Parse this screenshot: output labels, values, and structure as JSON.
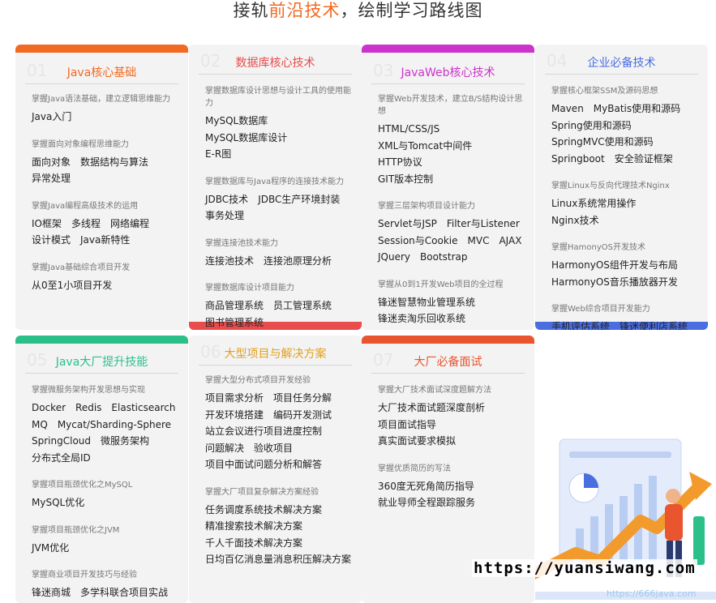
{
  "title": {
    "prefix": "接轨",
    "highlight": "前沿技术",
    "suffix": "，绘制学习路线图"
  },
  "cards": [
    {
      "num": "01",
      "title": "Java核心基础",
      "color": "#f26a21",
      "sections": [
        {
          "cap": "掌握Java语法基础，建立逻辑思维能力",
          "items": [
            "Java入门"
          ]
        },
        {
          "cap": "掌握面向对象编程思维能力",
          "items": [
            "面向对象",
            "数据结构与算法",
            "异常处理"
          ]
        },
        {
          "cap": "掌握Java编程高级技术的运用",
          "items": [
            "IO框架",
            "多线程",
            "网络编程",
            "设计模式",
            "Java新特性"
          ]
        },
        {
          "cap": "掌握Java基础综合项目开发",
          "items": [
            "从0至1小项目开发"
          ]
        }
      ]
    },
    {
      "num": "02",
      "title": "数据库核心技术",
      "color": "#e84c4c",
      "sections": [
        {
          "cap": "掌握数据库设计思想与设计工具的使用能力",
          "items": [
            "MySQL数据库",
            "MySQL数据库设计",
            "E-R图"
          ]
        },
        {
          "cap": "掌握数据库与Java程序的连接技术能力",
          "items": [
            "JDBC技术",
            "JDBC生产环境封装",
            "事务处理"
          ]
        },
        {
          "cap": "掌握连接池技术能力",
          "items": [
            "连接池技术",
            "连接池原理分析"
          ]
        },
        {
          "cap": "掌握数据库设计项目能力",
          "items": [
            "商品管理系统",
            "员工管理系统",
            "图书管理系统"
          ]
        }
      ]
    },
    {
      "num": "03",
      "title": "JavaWeb核心技术",
      "color": "#cc33cc",
      "sections": [
        {
          "cap": "掌握Web开发技术，建立B/S结构设计思想",
          "items": [
            "HTML/CSS/JS",
            "XML与Tomcat中间件",
            "HTTP协议",
            "GIT版本控制"
          ]
        },
        {
          "cap": "掌握三层架构项目设计能力",
          "items": [
            "Servlet与JSP",
            "Filter与Listener",
            "Session与Cookie",
            "MVC",
            "AJAX",
            "JQuery",
            "Bootstrap"
          ]
        },
        {
          "cap": "掌握从0到1开发Web项目的全过程",
          "items": [
            "锋迷智慧物业管理系统",
            "锋迷卖淘乐回收系统"
          ]
        }
      ]
    },
    {
      "num": "04",
      "title": "企业必备技术",
      "color": "#4a6ee0",
      "sections": [
        {
          "cap": "掌握核心框架SSM及源码思想",
          "items": [
            "Maven",
            "MyBatis使用和源码",
            "Spring使用和源码",
            "SpringMVC使用和源码",
            "Springboot",
            "安全验证框架"
          ]
        },
        {
          "cap": "掌握Linux与反向代理技术Nginx",
          "items": [
            "Linux系统常用操作",
            "Nginx技术"
          ]
        },
        {
          "cap": "掌握HamonyOS开发技术",
          "items": [
            "HarmonyOS组件开发与布局",
            "HarmonyOS音乐播放器开发"
          ]
        },
        {
          "cap": "掌握Web综合项目开发能力",
          "items": [
            "手机评估系统",
            "锋迷便利店系统"
          ]
        }
      ]
    },
    {
      "num": "05",
      "title": "Java大厂提升技能",
      "color": "#2bbf8a",
      "sections": [
        {
          "cap": "掌握微服务架构开发思想与实现",
          "items": [
            "Docker",
            "Redis",
            "Elasticsearch",
            "MQ",
            "Mycat/Sharding-Sphere",
            "SpringCloud",
            "微服务架构",
            "分布式全局ID"
          ]
        },
        {
          "cap": "掌握项目瓶颈优化之MySQL",
          "items": [
            "MySQL优化"
          ]
        },
        {
          "cap": "掌握项目瓶颈优化之JVM",
          "items": [
            "JVM优化"
          ]
        },
        {
          "cap": "掌握商业项目开发技巧与经验",
          "items": [
            "锋迷商城",
            "多学科联合项目实战"
          ]
        }
      ]
    },
    {
      "num": "06",
      "title": "大型项目与解决方案",
      "color": "#e0a020",
      "sections": [
        {
          "cap": "掌握大型分布式项目开发经验",
          "items": [
            "项目需求分析",
            "项目任务分解",
            "开发环境搭建",
            "编码开发测试",
            "站立会议进行项目进度控制",
            "问题解决",
            "验收项目",
            "项目中面试问题分析和解答"
          ]
        },
        {
          "cap": "掌握大厂项目复杂解决方案经验",
          "items": [
            "任务调度系统技术解决方案",
            "精准搜索技术解决方案",
            "千人千面技术解决方案",
            "日均百亿消息量消息积压解决方案"
          ]
        }
      ]
    },
    {
      "num": "07",
      "title": "大厂必备面试",
      "color": "#e8552f",
      "sections": [
        {
          "cap": "掌握大厂技术面试深度题解方法",
          "items": [
            "大厂技术面试题深度剖析",
            "项目面试指导",
            "真实面试要求模拟"
          ]
        },
        {
          "cap": "掌握优质简历的写法",
          "items": [
            "360度无死角简历指导",
            "就业导师全程跟踪服务"
          ]
        }
      ]
    }
  ],
  "site_url": "https://yuansiwang.com",
  "watermark": "https://666java.com"
}
